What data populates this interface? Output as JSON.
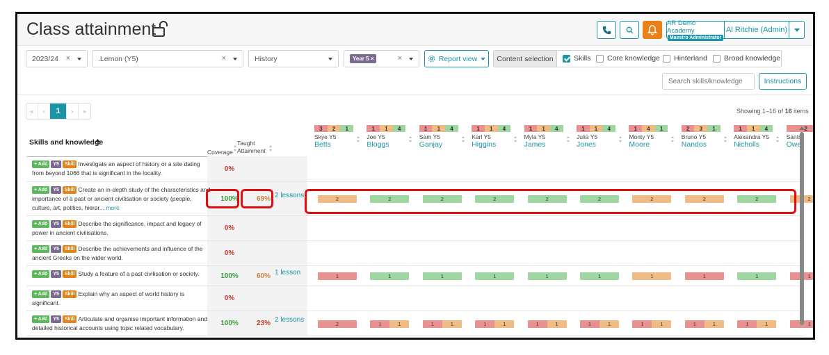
{
  "header": {
    "title": "Class attainment",
    "school_name": "AR Demo Academy",
    "school_role": "Maestro Administrator",
    "user_name": "Al Ritchie (Admin)"
  },
  "filters": {
    "year": "2023/24",
    "class": ".Lemon (Y5)",
    "subject": "History",
    "year_group_tag": "Year 5",
    "clear_glyph": "×",
    "tag_remove_glyph": "×",
    "report_view_label": "Report view",
    "content_selection_label": "Content selection",
    "content_options": [
      {
        "label": "Skills",
        "checked": true
      },
      {
        "label": "Core knowledge",
        "checked": false
      },
      {
        "label": "Hinterland",
        "checked": false
      },
      {
        "label": "Broad knowledge",
        "checked": false
      }
    ],
    "search_placeholder": "Search skills/knowledge",
    "instructions_label": "Instructions"
  },
  "pagination": {
    "first": "«",
    "prev": "‹",
    "current": "1",
    "next": "›",
    "last": "»",
    "showing_prefix": "Showing 1–16 of ",
    "showing_total": "16",
    "showing_suffix": " items"
  },
  "table": {
    "skills_header": "Skills and knowledge",
    "coverage_header": "Coverage",
    "taught_header": "Taught",
    "attainment_header": "Attainment"
  },
  "pupils": [
    {
      "first": "Skye Y5",
      "last": "Betts",
      "bar": [
        [
          "r",
          "3"
        ],
        [
          "o",
          "2"
        ],
        [
          "g",
          "1"
        ]
      ]
    },
    {
      "first": "Joe Y5",
      "last": "Bloggs",
      "bar": [
        [
          "r",
          "1"
        ],
        [
          "o",
          "1"
        ],
        [
          "g",
          "4"
        ]
      ]
    },
    {
      "first": "Sam Y5",
      "last": "Ganjay",
      "bar": [
        [
          "r",
          "1"
        ],
        [
          "o",
          "1"
        ],
        [
          "g",
          "4"
        ]
      ]
    },
    {
      "first": "Karl Y5",
      "last": "Higgins",
      "bar": [
        [
          "r",
          "1"
        ],
        [
          "o",
          "1"
        ],
        [
          "g",
          "4"
        ]
      ]
    },
    {
      "first": "Myla Y5",
      "last": "James",
      "bar": [
        [
          "r",
          "1"
        ],
        [
          "o",
          "1"
        ],
        [
          "g",
          "4"
        ]
      ]
    },
    {
      "first": "Julia Y5",
      "last": "Jones",
      "bar": [
        [
          "r",
          "1"
        ],
        [
          "o",
          "1"
        ],
        [
          "g",
          "4"
        ]
      ]
    },
    {
      "first": "Monty Y5",
      "last": "Moore",
      "bar": [
        [
          "r",
          "1"
        ],
        [
          "o",
          "4"
        ],
        [
          "g",
          "1"
        ]
      ]
    },
    {
      "first": "Bruno Y5",
      "last": "Nandos",
      "bar": [
        [
          "r",
          "2"
        ],
        [
          "o",
          "3"
        ],
        [
          "g",
          "1"
        ]
      ]
    },
    {
      "first": "Alexandra Y5",
      "last": "Nicholls",
      "bar": [
        [
          "r",
          "1"
        ],
        [
          "o",
          "1"
        ],
        [
          "g",
          "4"
        ]
      ]
    },
    {
      "first": "Santi",
      "last": "Owe",
      "bar": [
        [
          "r",
          "2"
        ]
      ]
    }
  ],
  "badges": {
    "add": "+ Add",
    "y5": "Y5",
    "skill": "Skill"
  },
  "rows": [
    {
      "text": "Investigate an aspect of history or a site dating from beyond 1066 that is significant in the locality.",
      "more": "",
      "coverage": "0%",
      "attainment": "",
      "lessons": "",
      "cells": []
    },
    {
      "text": "Create an in-depth study of the characteristics and importance of a past or ancient civilisation or society (people, culture, art, politics, hierar...",
      "more": "more",
      "coverage": "100%",
      "attainment": "69%",
      "lessons": "2 lessons",
      "cells": [
        [
          [
            "o",
            "2"
          ]
        ],
        [
          [
            "g",
            "2"
          ]
        ],
        [
          [
            "g",
            "2"
          ]
        ],
        [
          [
            "g",
            "2"
          ]
        ],
        [
          [
            "g",
            "2"
          ]
        ],
        [
          [
            "g",
            "2"
          ]
        ],
        [
          [
            "o",
            "2"
          ]
        ],
        [
          [
            "o",
            "2"
          ]
        ],
        [
          [
            "g",
            "2"
          ]
        ],
        [
          [
            "o",
            "2"
          ]
        ]
      ]
    },
    {
      "text": "Describe the significance, impact and legacy of power in ancient civilisations.",
      "more": "",
      "coverage": "0%",
      "attainment": "",
      "lessons": "",
      "cells": []
    },
    {
      "text": "Describe the achievements and influence of the ancient Greeks on the wider world.",
      "more": "",
      "coverage": "0%",
      "attainment": "",
      "lessons": "",
      "cells": []
    },
    {
      "text": "Study a feature of a past civilisation or society.",
      "more": "",
      "coverage": "100%",
      "attainment": "60%",
      "lessons": "1 lesson",
      "cells": [
        [
          [
            "r",
            "1"
          ]
        ],
        [
          [
            "g",
            "1"
          ]
        ],
        [
          [
            "g",
            "1"
          ]
        ],
        [
          [
            "g",
            "1"
          ]
        ],
        [
          [
            "g",
            "1"
          ]
        ],
        [
          [
            "g",
            "1"
          ]
        ],
        [
          [
            "o",
            "1"
          ]
        ],
        [
          [
            "r",
            "1"
          ]
        ],
        [
          [
            "g",
            "1"
          ]
        ],
        [
          [
            "r",
            "1"
          ]
        ]
      ]
    },
    {
      "text": "Explain why an aspect of world history is significant.",
      "more": "",
      "coverage": "0%",
      "attainment": "",
      "lessons": "",
      "cells": []
    },
    {
      "text": "Articulate and organise important information and detailed historical accounts using topic related vocabulary.",
      "more": "",
      "coverage": "100%",
      "attainment": "23%",
      "lessons": "2 lessons",
      "cells": [
        [
          [
            "r",
            "2"
          ]
        ],
        [
          [
            "r",
            "1"
          ],
          [
            "o",
            "1"
          ]
        ],
        [
          [
            "r",
            "1"
          ],
          [
            "o",
            "1"
          ]
        ],
        [
          [
            "r",
            "1"
          ],
          [
            "o",
            "1"
          ]
        ],
        [
          [
            "r",
            "1"
          ],
          [
            "o",
            "1"
          ]
        ],
        [
          [
            "r",
            "1"
          ],
          [
            "o",
            "1"
          ]
        ],
        [
          [
            "r",
            "1"
          ],
          [
            "o",
            "1"
          ]
        ],
        [
          [
            "r",
            "1"
          ],
          [
            "o",
            "1"
          ]
        ],
        [
          [
            "r",
            "1"
          ],
          [
            "o",
            "1"
          ]
        ],
        [
          [
            "r",
            "1"
          ]
        ]
      ]
    }
  ],
  "colors": {
    "accent": "#1a94a6",
    "bell": "#e8811a",
    "good": "#3c9d3c",
    "poor": "#c0392b",
    "mid": "#c98240",
    "highlight": "#e01010"
  }
}
